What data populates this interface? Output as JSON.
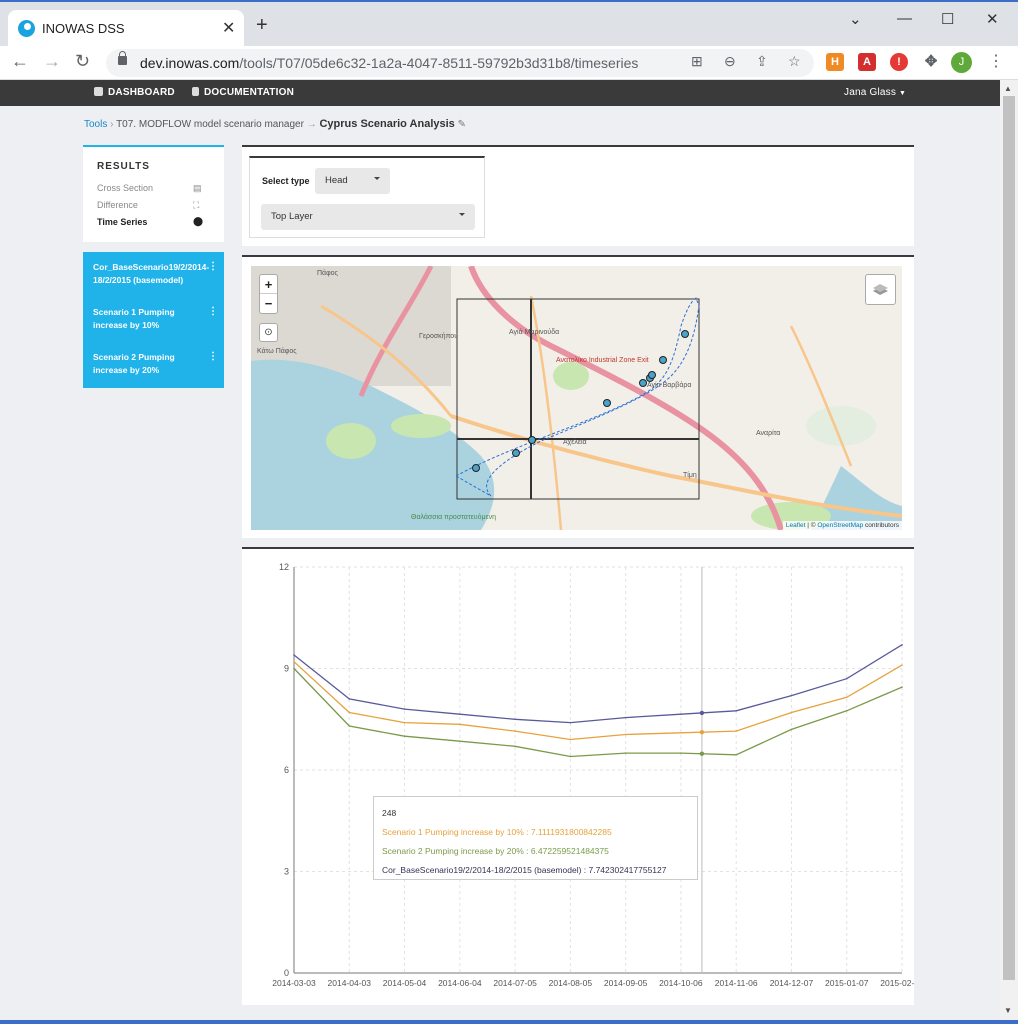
{
  "browser": {
    "tab_title": "INOWAS DSS",
    "url_host": "dev.inowas.com",
    "url_path": "/tools/T07/05de6c32-1a2a-4047-8511-59792b3d31b8/timeseries",
    "profile_initial": "J"
  },
  "appbar": {
    "dashboard": "DASHBOARD",
    "documentation": "DOCUMENTATION",
    "user": "Jana Glass"
  },
  "breadcrumb": {
    "tools": "Tools",
    "tool": "T07. MODFLOW model scenario manager",
    "current": "Cyprus Scenario Analysis"
  },
  "results": {
    "title": "RESULTS",
    "items": [
      {
        "label": "Cross Section",
        "icon": "calendar-icon"
      },
      {
        "label": "Difference",
        "icon": "expand-icon"
      },
      {
        "label": "Time Series",
        "icon": "map-pin-icon"
      }
    ]
  },
  "scenarios": [
    "Cor_BaseScenario19/2/2014-18/2/2015 (basemodel)",
    "Scenario 1 Pumping increase by 10%",
    "Scenario 2 Pumping increase by 20%"
  ],
  "selectors": {
    "type_label": "Select type",
    "type_value": "Head",
    "layer_value": "Top Layer"
  },
  "map": {
    "labels": [
      "Πάφος",
      "Γεροσκήπου",
      "Αγιά Μαρινούδα",
      "Αγία Βαρβάρα",
      "Αχέλεια",
      "Τίμη",
      "Κάτω Πάφος",
      "Ανατολίκο Industrial Zone Exit",
      "Αναρίτα",
      "Θαλάσσια προστατευόμενη"
    ],
    "attribution_leaflet": "Leaflet",
    "attribution_mid": " | © ",
    "attribution_osm": "OpenStreetMap",
    "attribution_end": " contributors",
    "colors": {
      "land": "#f2efe9",
      "sea": "#aad3df",
      "highway": "#e892a2",
      "road": "#f8c68a",
      "green": "#c8e6b0",
      "urban": "#dcd8d2"
    }
  },
  "chart_data": {
    "type": "line",
    "x": [
      "2014-03-03",
      "2014-04-03",
      "2014-05-04",
      "2014-06-04",
      "2014-07-05",
      "2014-08-05",
      "2014-09-05",
      "2014-10-06",
      "2014-11-06",
      "2014-12-07",
      "2015-01-07",
      "2015-02-19"
    ],
    "ylim": [
      0,
      12
    ],
    "yticks": [
      0,
      3,
      6,
      9,
      12
    ],
    "grid": true,
    "series": [
      {
        "name": "Cor_BaseScenario19/2/2014-18/2/2015 (basemodel)",
        "color": "#5a5a9a",
        "values": [
          9.4,
          8.1,
          7.8,
          7.65,
          7.5,
          7.4,
          7.55,
          7.65,
          7.75,
          8.2,
          8.7,
          9.7
        ]
      },
      {
        "name": "Scenario 1 Pumping increase by 10%",
        "color": "#e6a23c",
        "values": [
          9.2,
          7.7,
          7.4,
          7.35,
          7.15,
          6.9,
          7.05,
          7.1,
          7.15,
          7.7,
          8.15,
          9.1
        ]
      },
      {
        "name": "Scenario 2 Pumping increase by 20%",
        "color": "#7a9a4a",
        "values": [
          9.0,
          7.3,
          7.0,
          6.85,
          6.7,
          6.4,
          6.5,
          6.5,
          6.45,
          7.2,
          7.75,
          8.45
        ]
      }
    ]
  },
  "tooltip": {
    "index": "248",
    "s1": "Scenario 1 Pumping increase by 10% : 7.1111931800842285",
    "s2": "Scenario 2 Pumping increase by 20% : 6.472259521484375",
    "base": "Cor_BaseScenario19/2/2014-18/2/2015 (basemodel) : 7.742302417755127",
    "colors": {
      "s1": "#e6a23c",
      "s2": "#7a9a4a",
      "base": "#333355"
    }
  }
}
